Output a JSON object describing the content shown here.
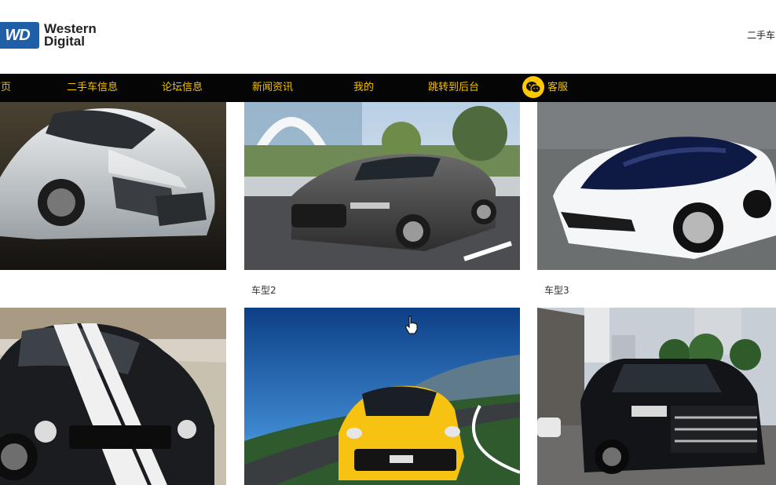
{
  "header": {
    "logo": {
      "badge_text": "WD",
      "line1": "Western",
      "line2": "Digital"
    },
    "right_link": "二手车"
  },
  "nav": {
    "items": [
      {
        "label": "首页"
      },
      {
        "label": "二手车信息"
      },
      {
        "label": "论坛信息"
      },
      {
        "label": "新闻资讯"
      },
      {
        "label": "我的"
      },
      {
        "label": "跳转到后台"
      },
      {
        "label": "客服"
      }
    ],
    "colors": {
      "bar": "#050505",
      "text": "#f2c200",
      "wechat": "#ffc800"
    }
  },
  "cards": [
    {
      "caption": "",
      "image": "silver-supercar"
    },
    {
      "caption": "车型2",
      "image": "grey-sedan"
    },
    {
      "caption": "车型3",
      "image": "white-concept-car"
    },
    {
      "caption": "",
      "image": "black-muscle-car"
    },
    {
      "caption": "",
      "image": "yellow-sports-car"
    },
    {
      "caption": "",
      "image": "black-suv"
    }
  ]
}
